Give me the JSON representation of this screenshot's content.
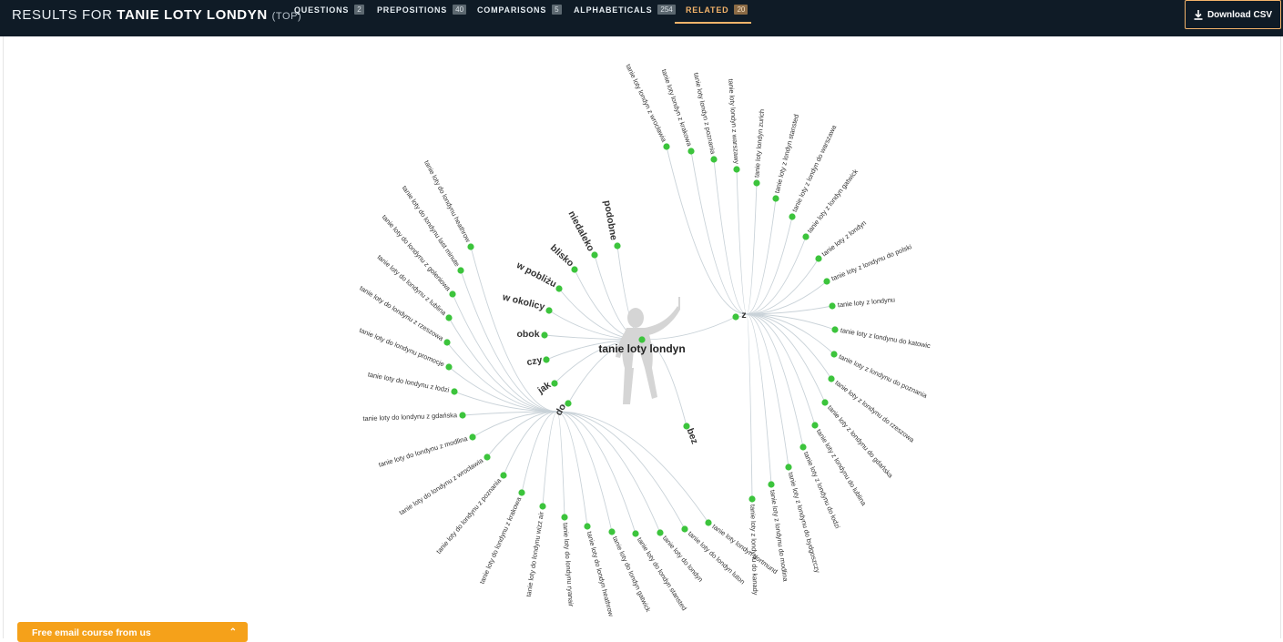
{
  "header": {
    "prefix": "RESULTS FOR",
    "keyword": "TANIE LOTY LONDYN",
    "mode": "(TOP)"
  },
  "tabs": [
    {
      "label": "QUESTIONS",
      "count": "2"
    },
    {
      "label": "PREPOSITIONS",
      "count": "40"
    },
    {
      "label": "COMPARISONS",
      "count": "5"
    },
    {
      "label": "ALPHABETICALS",
      "count": "254"
    },
    {
      "label": "RELATED",
      "count": "20"
    }
  ],
  "download_label": "Download CSV",
  "email_bar_label": "Free email course from us",
  "colors": {
    "topbar": "#0f1b26",
    "accent": "#f3b36a",
    "node": "#3cc43c",
    "link": "#c9d2d8",
    "email": "#f5a11a"
  },
  "wheel": {
    "center": "tanie loty londyn",
    "modifiers": [
      "podobne",
      "niedaleko",
      "blisko",
      "w pobliżu",
      "w okolicy",
      "obok",
      "czy",
      "jak",
      "do",
      "z",
      "bez"
    ],
    "z_leaves": [
      "tanie loty londyn z wrocławia",
      "tanie loty londyn z krakowa",
      "tanie loty londyn z poznania",
      "tanie loty londyn z warszawy",
      "tanie loty londyn zurich",
      "tanie loty z londyn stansted",
      "tanie loty z londyn do warszawa",
      "tanie loty z londyn gatwick",
      "tanie loty z londyn",
      "tanie loty z londynu do polski",
      "tanie loty z londynu",
      "tanie loty z londynu do katowic",
      "tanie loty z londynu do poznania",
      "tanie loty z londynu do rzeszowa",
      "tanie loty z londynu do gdańska",
      "tanie loty z londynu do lublina",
      "tanie loty z londynu do łodzi",
      "tanie loty z londynu do bydgoszczy",
      "tanie loty z londynu do modlina",
      "tanie loty z londynu do kanady"
    ],
    "do_leaves": [
      "tanie loty do londynu heathrow",
      "tanie loty do londynu last minute",
      "tanie loty do londynu z goleniowa",
      "tanie loty do londynu z lublina",
      "tanie loty do londynu z rzeszowa",
      "tanie loty do londynu promocje",
      "tanie loty do londynu z łodzi",
      "tanie loty do londynu z gdańska",
      "tanie loty do londynu z modlina",
      "tanie loty do londynu z wrocławia",
      "tanie loty do londynu z poznania",
      "tanie loty do londynu z krakowa",
      "tanie loty do londynu wizz air",
      "tanie loty do londynu ryanair",
      "tanie loty do londyn heathrow",
      "tanie loty do londyn gatwick",
      "tanie loty do londyn stansted",
      "tanie loty do londyn",
      "tanie loty do londyn luton",
      "tanie loty londyn dortmund"
    ]
  }
}
